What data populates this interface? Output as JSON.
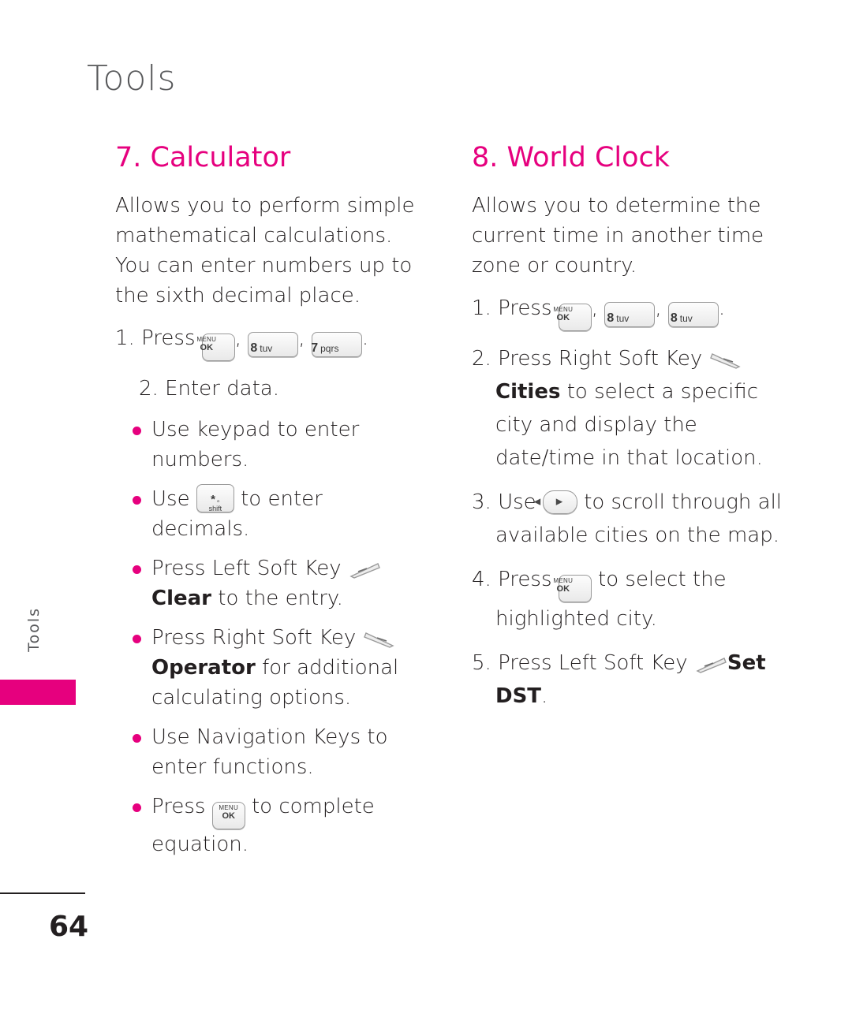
{
  "header": {
    "chapter": "Tools"
  },
  "side_tab": {
    "label": "Tools",
    "bar_color": "#e6007e"
  },
  "accent_color": "#e6007e",
  "keys": {
    "menu_ok": {
      "line1": "MENU",
      "line2": "OK",
      "name": "menu-ok-key"
    },
    "num8": {
      "num": "8",
      "sub": "tuv"
    },
    "num7": {
      "num": "7",
      "sub": "pqrs"
    },
    "star": {
      "glyph": "*",
      "lock": "▫",
      "sub": "shift"
    },
    "nav": {
      "left": "◀",
      "right": "▶"
    }
  },
  "left_column": {
    "title": "7. Calculator",
    "intro": "Allows you to perform simple mathematical calculations. You can enter numbers up to the sixth decimal place.",
    "steps": [
      {
        "num": "1.",
        "text_before": "Press",
        "keys": [
          "menu_ok",
          "num8",
          "num7"
        ],
        "text_after": "."
      },
      {
        "num": "2.",
        "text_before": "Enter data.",
        "keys": [],
        "text_after": ""
      }
    ],
    "bullets": [
      {
        "parts": [
          {
            "t": "Use keypad to enter numbers."
          }
        ]
      },
      {
        "parts": [
          {
            "t": "Use"
          },
          {
            "key": "star"
          },
          {
            "t": "to enter decimals."
          }
        ]
      },
      {
        "parts": [
          {
            "t": "Press Left Soft Key"
          },
          {
            "key": "softkey-left"
          },
          {
            "t": "Clear",
            "bold": true
          },
          {
            "t": "to the entry."
          }
        ]
      },
      {
        "parts": [
          {
            "t": "Press Right Soft Key"
          },
          {
            "key": "softkey-right"
          },
          {
            "t": "Operator",
            "bold": true
          },
          {
            "t": "for additional calculating options."
          }
        ]
      },
      {
        "parts": [
          {
            "t": "Use Navigation Keys to enter functions."
          }
        ]
      },
      {
        "parts": [
          {
            "t": "Press"
          },
          {
            "key": "menu_ok"
          },
          {
            "t": "to complete equation."
          }
        ]
      }
    ]
  },
  "right_column": {
    "title": "8. World Clock",
    "intro": "Allows you to determine the current time in another time zone or country.",
    "steps": [
      {
        "num": "1.",
        "text_before": "Press",
        "keys": [
          "menu_ok",
          "num8",
          "num8"
        ],
        "text_after": "."
      },
      {
        "num": "2.",
        "text_before": "Press Right Soft Key",
        "bold_word": "Cities",
        "text_after": "to select a specific city and display the date/time in that location."
      },
      {
        "num": "3.",
        "text_before": "Use",
        "text_after": "to scroll through all available cities on the map."
      },
      {
        "num": "4.",
        "text_before": "Press",
        "text_after": "to select the highlighted city."
      },
      {
        "num": "5.",
        "text_before": "Press Left Soft Key",
        "bold_word": "Set DST",
        "text_after": "."
      }
    ]
  },
  "footer": {
    "page_number": "64"
  }
}
